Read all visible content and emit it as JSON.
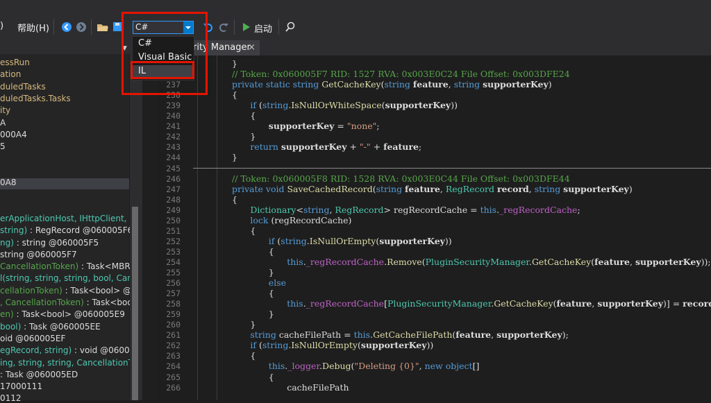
{
  "menu": {
    "help": "帮助(H)",
    "paren": ")"
  },
  "toolbar": {
    "language_value": "C#",
    "start_label": "启动"
  },
  "language_options": [
    {
      "label": "C#",
      "selected": false
    },
    {
      "label": "Visual Basic",
      "selected": false
    },
    {
      "label": "IL",
      "selected": true
    }
  ],
  "tab": {
    "title": "rity Manager",
    "close": "×"
  },
  "tree_rows": [
    [
      {
        "t": "essRun",
        "c": "#d7ba7d"
      }
    ],
    [
      {
        "t": "ation",
        "c": "#d7ba7d"
      }
    ],
    [
      {
        "t": "duledTasks",
        "c": "#d7ba7d"
      }
    ],
    [
      {
        "t": "duledTasks.Tasks",
        "c": "#d7ba7d"
      }
    ],
    [
      {
        "t": "ity",
        "c": "#d7ba7d"
      }
    ],
    [
      {
        "t": "A",
        "c": "#dcdcdc"
      }
    ],
    [
      {
        "t": "000A4",
        "c": "#dcdcdc"
      }
    ],
    [
      {
        "t": "5",
        "c": "#dcdcdc"
      }
    ],
    [
      {
        "t": "",
        "c": "#dcdcdc"
      }
    ],
    [
      {
        "t": "",
        "c": "#dcdcdc"
      }
    ],
    [
      {
        "t": "0A8",
        "c": "#dcdcdc"
      }
    ],
    [
      {
        "t": "",
        "c": "#dcdcdc"
      }
    ],
    [
      {
        "t": "",
        "c": "#dcdcdc"
      }
    ],
    [
      {
        "t": "erApplicationHost, IHttpClient, IJ",
        "c": "#4ec9b0"
      }
    ],
    [
      {
        "t": " string)",
        "c": "#4ec9b0"
      },
      {
        "t": " : RegRecord @060005F6",
        "c": "#dcdcdc"
      }
    ],
    [
      {
        "t": "ng)",
        "c": "#4ec9b0"
      },
      {
        "t": " : string @060005F5",
        "c": "#dcdcdc"
      }
    ],
    [
      {
        "t": "string @060005F7",
        "c": "#dcdcdc"
      }
    ],
    [
      {
        "t": " CancellationToken)",
        "c": "#57a64a"
      },
      {
        "t": " : Task<MBRe",
        "c": "#dcdcdc"
      }
    ],
    [
      {
        "t": "l(string, string, string, bool, Canc",
        "c": "#4ec9b0"
      }
    ],
    [
      {
        "t": "cellationToken)",
        "c": "#57a64a"
      },
      {
        "t": " : Task<bool> @0",
        "c": "#dcdcdc"
      }
    ],
    [
      {
        "t": ", CancellationToken)",
        "c": "#57a64a"
      },
      {
        "t": " : Task<bool",
        "c": "#dcdcdc"
      }
    ],
    [
      {
        "t": "en)",
        "c": "#57a64a"
      },
      {
        "t": " : Task<bool> @060005E9",
        "c": "#dcdcdc"
      }
    ],
    [
      {
        "t": " bool)",
        "c": "#4ec9b0"
      },
      {
        "t": " : Task @060005EE",
        "c": "#dcdcdc"
      }
    ],
    [
      {
        "t": "oid @060005EF",
        "c": "#dcdcdc"
      }
    ],
    [
      {
        "t": "egRecord, string)",
        "c": "#4ec9b0"
      },
      {
        "t": " : void @060005",
        "c": "#dcdcdc"
      }
    ],
    [
      {
        "t": "ing, string, string, CancellationTo",
        "c": "#4ec9b0"
      }
    ],
    [
      {
        "t": ": Task @060005ED",
        "c": "#dcdcdc"
      }
    ],
    [
      {
        "t": "17000111",
        "c": "#dcdcdc"
      }
    ],
    [
      {
        "t": "0112",
        "c": "#dcdcdc"
      }
    ]
  ],
  "code_lines": [
    {
      "n": "",
      "i": 4,
      "p": [
        {
          "t": "}",
          "c": ""
        }
      ]
    },
    {
      "n": "236",
      "i": 4,
      "p": [
        {
          "t": "// Token: 0x060005F7 RID: 1527 RVA: 0x003E0C24 File Offset: 0x003DFE24",
          "c": "c"
        }
      ]
    },
    {
      "n": "237",
      "i": 4,
      "p": [
        {
          "t": "private static ",
          "c": "k"
        },
        {
          "t": "string ",
          "c": "k"
        },
        {
          "t": "GetCacheKey",
          "c": "m"
        },
        {
          "t": "(",
          "c": ""
        },
        {
          "t": "string ",
          "c": "k"
        },
        {
          "t": "feature",
          "c": "b"
        },
        {
          "t": ", ",
          "c": ""
        },
        {
          "t": "string ",
          "c": "k"
        },
        {
          "t": "supporterKey",
          "c": "b"
        },
        {
          "t": ")",
          "c": ""
        }
      ]
    },
    {
      "n": "238",
      "i": 4,
      "p": [
        {
          "t": "{",
          "c": ""
        }
      ]
    },
    {
      "n": "239",
      "i": 8,
      "p": [
        {
          "t": "if ",
          "c": "k"
        },
        {
          "t": "(",
          "c": ""
        },
        {
          "t": "string",
          "c": "k"
        },
        {
          "t": ".",
          "c": ""
        },
        {
          "t": "IsNullOrWhiteSpace",
          "c": "m"
        },
        {
          "t": "(",
          "c": ""
        },
        {
          "t": "supporterKey",
          "c": "b"
        },
        {
          "t": "))",
          "c": ""
        }
      ]
    },
    {
      "n": "240",
      "i": 8,
      "p": [
        {
          "t": "{",
          "c": ""
        }
      ]
    },
    {
      "n": "241",
      "i": 12,
      "p": [
        {
          "t": "supporterKey",
          "c": "b"
        },
        {
          "t": " = ",
          "c": ""
        },
        {
          "t": "\"none\"",
          "c": "s"
        },
        {
          "t": ";",
          "c": ""
        }
      ]
    },
    {
      "n": "242",
      "i": 8,
      "p": [
        {
          "t": "}",
          "c": ""
        }
      ]
    },
    {
      "n": "243",
      "i": 8,
      "p": [
        {
          "t": "return ",
          "c": "k"
        },
        {
          "t": "supporterKey",
          "c": "b"
        },
        {
          "t": " + ",
          "c": ""
        },
        {
          "t": "\"-\"",
          "c": "s"
        },
        {
          "t": " + ",
          "c": ""
        },
        {
          "t": "feature",
          "c": "b"
        },
        {
          "t": ";",
          "c": ""
        }
      ]
    },
    {
      "n": "244",
      "i": 4,
      "p": [
        {
          "t": "}",
          "c": ""
        }
      ]
    },
    {
      "n": "245",
      "i": 4,
      "p": []
    },
    {
      "n": "246",
      "i": 4,
      "p": [
        {
          "t": "// Token: 0x060005F8 RID: 1528 RVA: 0x003E0C44 File Offset: 0x003DFE44",
          "c": "c"
        }
      ]
    },
    {
      "n": "247",
      "i": 4,
      "p": [
        {
          "t": "private void ",
          "c": "k"
        },
        {
          "t": "SaveCachedRecord",
          "c": "m"
        },
        {
          "t": "(",
          "c": ""
        },
        {
          "t": "string ",
          "c": "k"
        },
        {
          "t": "feature",
          "c": "b"
        },
        {
          "t": ", ",
          "c": ""
        },
        {
          "t": "RegRecord ",
          "c": "t"
        },
        {
          "t": "record",
          "c": "b"
        },
        {
          "t": ", ",
          "c": ""
        },
        {
          "t": "string ",
          "c": "k"
        },
        {
          "t": "supporterKey",
          "c": "b"
        },
        {
          "t": ")",
          "c": ""
        }
      ]
    },
    {
      "n": "248",
      "i": 4,
      "p": [
        {
          "t": "{",
          "c": ""
        }
      ]
    },
    {
      "n": "249",
      "i": 8,
      "p": [
        {
          "t": "Dictionary",
          "c": "t"
        },
        {
          "t": "<",
          "c": ""
        },
        {
          "t": "string",
          "c": "k"
        },
        {
          "t": ", ",
          "c": ""
        },
        {
          "t": "RegRecord",
          "c": "t"
        },
        {
          "t": "> regRecordCache = ",
          "c": ""
        },
        {
          "t": "this",
          "c": "k"
        },
        {
          "t": ".",
          "c": ""
        },
        {
          "t": "_regRecordCache",
          "c": "f"
        },
        {
          "t": ";",
          "c": ""
        }
      ]
    },
    {
      "n": "250",
      "i": 8,
      "p": [
        {
          "t": "lock ",
          "c": "k"
        },
        {
          "t": "(regRecordCache)",
          "c": ""
        }
      ]
    },
    {
      "n": "251",
      "i": 8,
      "p": [
        {
          "t": "{",
          "c": ""
        }
      ]
    },
    {
      "n": "252",
      "i": 12,
      "p": [
        {
          "t": "if ",
          "c": "k"
        },
        {
          "t": "(",
          "c": ""
        },
        {
          "t": "string",
          "c": "k"
        },
        {
          "t": ".",
          "c": ""
        },
        {
          "t": "IsNullOrEmpty",
          "c": "m"
        },
        {
          "t": "(",
          "c": ""
        },
        {
          "t": "supporterKey",
          "c": "b"
        },
        {
          "t": "))",
          "c": ""
        }
      ]
    },
    {
      "n": "253",
      "i": 12,
      "p": [
        {
          "t": "{",
          "c": ""
        }
      ]
    },
    {
      "n": "254",
      "i": 16,
      "p": [
        {
          "t": "this",
          "c": "k"
        },
        {
          "t": ".",
          "c": ""
        },
        {
          "t": "_regRecordCache",
          "c": "f"
        },
        {
          "t": ".",
          "c": ""
        },
        {
          "t": "Remove",
          "c": "m"
        },
        {
          "t": "(",
          "c": ""
        },
        {
          "t": "PluginSecurityManager",
          "c": "t"
        },
        {
          "t": ".",
          "c": ""
        },
        {
          "t": "GetCacheKey",
          "c": "m"
        },
        {
          "t": "(",
          "c": ""
        },
        {
          "t": "feature",
          "c": "b"
        },
        {
          "t": ", ",
          "c": ""
        },
        {
          "t": "supporterKey",
          "c": "b"
        },
        {
          "t": "));",
          "c": ""
        }
      ]
    },
    {
      "n": "255",
      "i": 12,
      "p": [
        {
          "t": "}",
          "c": ""
        }
      ]
    },
    {
      "n": "256",
      "i": 12,
      "p": [
        {
          "t": "else",
          "c": "k"
        }
      ]
    },
    {
      "n": "257",
      "i": 12,
      "p": [
        {
          "t": "{",
          "c": ""
        }
      ]
    },
    {
      "n": "258",
      "i": 16,
      "p": [
        {
          "t": "this",
          "c": "k"
        },
        {
          "t": ".",
          "c": ""
        },
        {
          "t": "_regRecordCache",
          "c": "f"
        },
        {
          "t": "[",
          "c": ""
        },
        {
          "t": "PluginSecurityManager",
          "c": "t"
        },
        {
          "t": ".",
          "c": ""
        },
        {
          "t": "GetCacheKey",
          "c": "m"
        },
        {
          "t": "(",
          "c": ""
        },
        {
          "t": "feature",
          "c": "b"
        },
        {
          "t": ", ",
          "c": ""
        },
        {
          "t": "supporterKey",
          "c": "b"
        },
        {
          "t": ")] = ",
          "c": ""
        },
        {
          "t": "record",
          "c": "b"
        },
        {
          "t": ";",
          "c": ""
        }
      ]
    },
    {
      "n": "259",
      "i": 12,
      "p": [
        {
          "t": "}",
          "c": ""
        }
      ]
    },
    {
      "n": "260",
      "i": 8,
      "p": [
        {
          "t": "}",
          "c": ""
        }
      ]
    },
    {
      "n": "261",
      "i": 8,
      "p": [
        {
          "t": "string ",
          "c": "k"
        },
        {
          "t": "cacheFilePath = ",
          "c": ""
        },
        {
          "t": "this",
          "c": "k"
        },
        {
          "t": ".",
          "c": ""
        },
        {
          "t": "GetCacheFilePath",
          "c": "m"
        },
        {
          "t": "(",
          "c": ""
        },
        {
          "t": "feature",
          "c": "b"
        },
        {
          "t": ", ",
          "c": ""
        },
        {
          "t": "supporterKey",
          "c": "b"
        },
        {
          "t": ");",
          "c": ""
        }
      ]
    },
    {
      "n": "262",
      "i": 8,
      "p": [
        {
          "t": "if ",
          "c": "k"
        },
        {
          "t": "(",
          "c": ""
        },
        {
          "t": "string",
          "c": "k"
        },
        {
          "t": ".",
          "c": ""
        },
        {
          "t": "IsNullOrEmpty",
          "c": "m"
        },
        {
          "t": "(",
          "c": ""
        },
        {
          "t": "supporterKey",
          "c": "b"
        },
        {
          "t": "))",
          "c": ""
        }
      ]
    },
    {
      "n": "263",
      "i": 8,
      "p": [
        {
          "t": "{",
          "c": ""
        }
      ]
    },
    {
      "n": "264",
      "i": 12,
      "p": [
        {
          "t": "this",
          "c": "k"
        },
        {
          "t": ".",
          "c": ""
        },
        {
          "t": "_logger",
          "c": "f"
        },
        {
          "t": ".",
          "c": ""
        },
        {
          "t": "Debug",
          "c": "m"
        },
        {
          "t": "(",
          "c": ""
        },
        {
          "t": "\"Deleting {0}\"",
          "c": "s"
        },
        {
          "t": ", ",
          "c": ""
        },
        {
          "t": "new ",
          "c": "k"
        },
        {
          "t": "object",
          "c": "k"
        },
        {
          "t": "[]",
          "c": ""
        }
      ]
    },
    {
      "n": "265",
      "i": 12,
      "p": [
        {
          "t": "{",
          "c": ""
        }
      ]
    },
    {
      "n": "266",
      "i": 16,
      "p": [
        {
          "t": "cacheFilePath",
          "c": ""
        }
      ]
    }
  ]
}
